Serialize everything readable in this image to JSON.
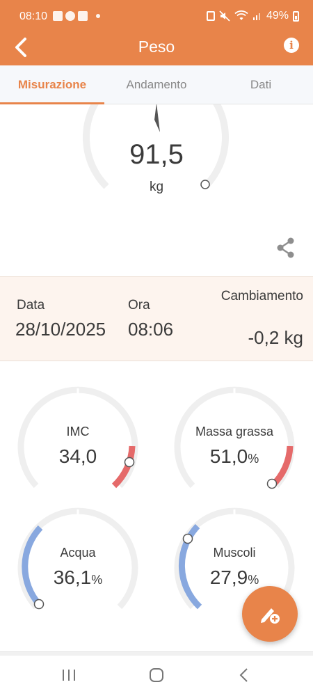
{
  "status_bar": {
    "time": "08:10",
    "battery": "49%"
  },
  "app_bar": {
    "title": "Peso",
    "back_icon": "chevron-left-icon",
    "info_icon": "info-icon",
    "info_glyph": "i"
  },
  "tabs": [
    {
      "label": "Misurazione",
      "active": true
    },
    {
      "label": "Andamento",
      "active": false
    },
    {
      "label": "Dati",
      "active": false
    }
  ],
  "main_gauge": {
    "value": "91,5",
    "unit": "kg"
  },
  "details": {
    "date_label": "Data",
    "date_value": "28/10/2025",
    "time_label": "Ora",
    "time_value": "08:06",
    "change_label": "Cambiamento",
    "change_value": "-0,2 kg"
  },
  "metrics": [
    {
      "label": "IMC",
      "value": "34,0",
      "unit": "",
      "color": "#e56a6a"
    },
    {
      "label": "Massa grassa",
      "value": "51,0",
      "unit": "%",
      "color": "#e56a6a"
    },
    {
      "label": "Acqua",
      "value": "36,1",
      "unit": "%",
      "color": "#88a8df"
    },
    {
      "label": "Muscoli",
      "value": "27,9",
      "unit": "%",
      "color": "#88a8df"
    }
  ],
  "colors": {
    "accent": "#e8844a",
    "gauge_track": "#efefef",
    "alert": "#e56a6a",
    "cool": "#88a8df"
  },
  "fab": {
    "icon": "edit-add-icon"
  },
  "nav": {
    "recent_icon": "recent-apps-icon",
    "home_icon": "home-icon",
    "back_icon": "back-nav-icon"
  }
}
